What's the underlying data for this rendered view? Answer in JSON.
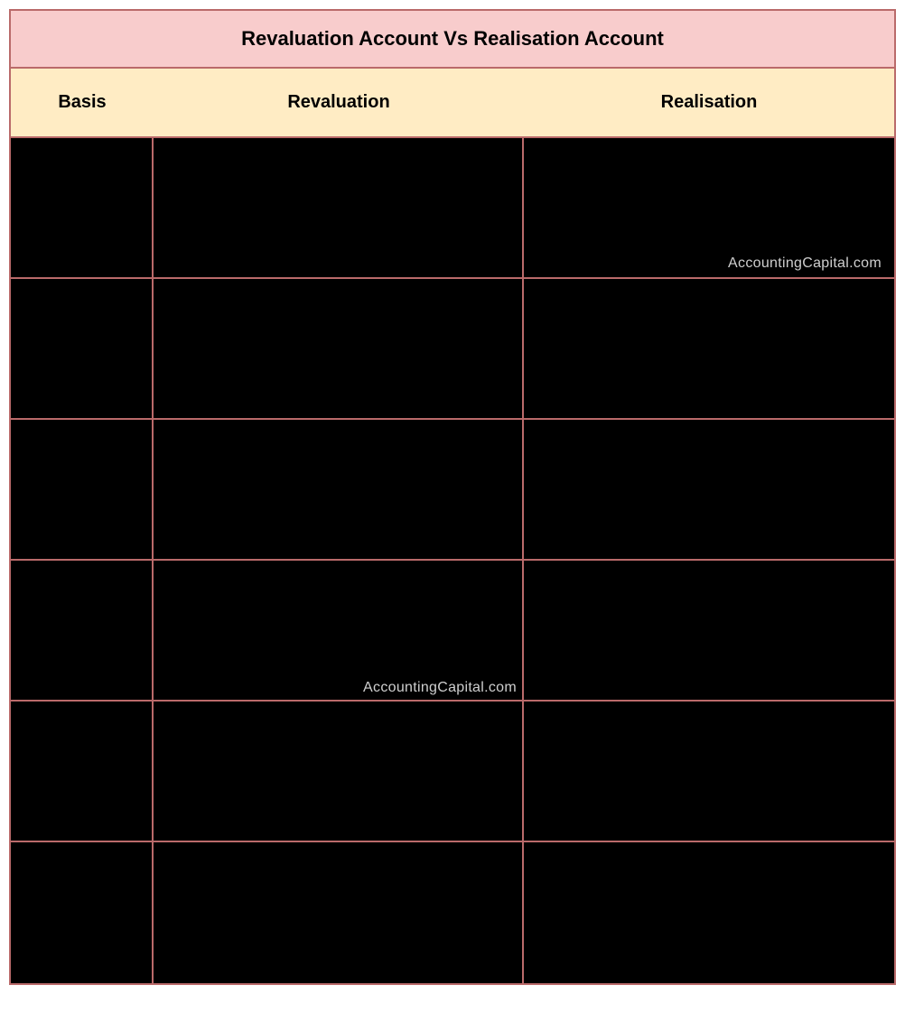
{
  "title": "Revaluation Account Vs Realisation Account",
  "headers": {
    "col1": "Basis",
    "col2": "Revaluation",
    "col3": "Realisation"
  },
  "watermarks": {
    "wm1": "AccountingCapital.com",
    "wm2": "AccountingCapital.com"
  },
  "rows": [
    {
      "basis": "",
      "revaluation": "",
      "realisation": ""
    },
    {
      "basis": "",
      "revaluation": "",
      "realisation": ""
    },
    {
      "basis": "",
      "revaluation": "",
      "realisation": ""
    },
    {
      "basis": "",
      "revaluation": "",
      "realisation": ""
    },
    {
      "basis": "",
      "revaluation": "",
      "realisation": ""
    },
    {
      "basis": "",
      "revaluation": "",
      "realisation": ""
    }
  ]
}
